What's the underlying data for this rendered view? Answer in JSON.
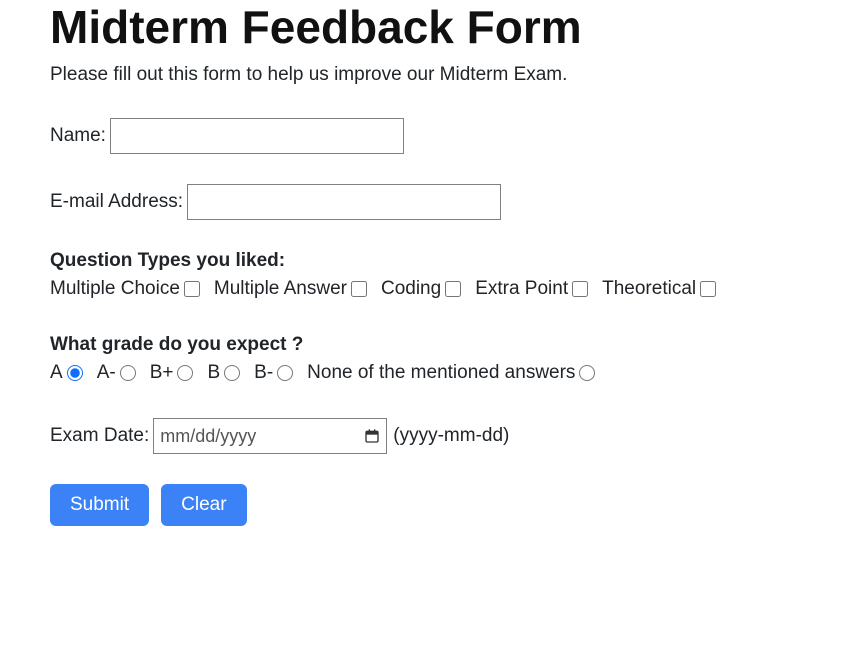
{
  "title": "Midterm Feedback Form",
  "intro": "Please fill out this form to help us improve our Midterm Exam.",
  "name": {
    "label": "Name:",
    "value": ""
  },
  "email": {
    "label": "E-mail Address:",
    "value": ""
  },
  "question_types": {
    "heading": "Question Types you liked:",
    "options": [
      {
        "label": "Multiple Choice"
      },
      {
        "label": "Multiple Answer"
      },
      {
        "label": "Coding"
      },
      {
        "label": "Extra Point"
      },
      {
        "label": "Theoretical"
      }
    ]
  },
  "grade": {
    "heading": "What grade do you expect ?",
    "options": [
      {
        "label": "A",
        "selected": true
      },
      {
        "label": "A-",
        "selected": false
      },
      {
        "label": "B+",
        "selected": false
      },
      {
        "label": "B",
        "selected": false
      },
      {
        "label": "B-",
        "selected": false
      },
      {
        "label": "None of the mentioned answers",
        "selected": false
      }
    ]
  },
  "exam_date": {
    "label": "Exam Date:",
    "placeholder": "mm/dd/yyyy",
    "hint": "(yyyy-mm-dd)"
  },
  "buttons": {
    "submit": "Submit",
    "clear": "Clear"
  }
}
